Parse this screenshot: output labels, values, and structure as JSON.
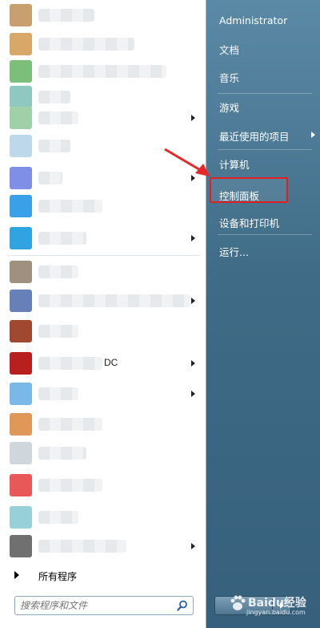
{
  "left_pane": {
    "programs": [
      {
        "icon_color": "#c8a070",
        "blur_w": 70,
        "arrow": false,
        "label": ""
      },
      {
        "icon_color": "#d8a868",
        "blur_w": 120,
        "arrow": false,
        "label": ""
      },
      {
        "icon_color": "#7bbf7b",
        "blur_w": 160,
        "arrow": false,
        "label": ""
      },
      {
        "icon_color": "#8fc7c1",
        "blur_w": 40,
        "arrow": false,
        "label": ""
      },
      {
        "icon_color": "#9fd0a8",
        "blur_w": 50,
        "arrow": true,
        "label": ""
      },
      {
        "icon_color": "#bcd8ea",
        "blur_w": 40,
        "arrow": false,
        "label": ""
      },
      {
        "icon_color": "#7f8fe8",
        "blur_w": 30,
        "arrow": true,
        "label": ""
      },
      {
        "icon_color": "#3aa0e8",
        "blur_w": 80,
        "arrow": false,
        "label": ""
      },
      {
        "icon_color": "#2fa4e0",
        "blur_w": 60,
        "arrow": true,
        "label": ""
      },
      {
        "icon_color": "#a09080",
        "blur_w": 50,
        "arrow": false,
        "label": ""
      },
      {
        "icon_color": "#6880b8",
        "blur_w": 190,
        "arrow": true,
        "label": ""
      },
      {
        "icon_color": "#a04830",
        "blur_w": 50,
        "arrow": false,
        "label": ""
      },
      {
        "icon_color": "#b82020",
        "blur_w": 80,
        "arrow": true,
        "label": "DC"
      },
      {
        "icon_color": "#7ab8e8",
        "blur_w": 50,
        "arrow": true,
        "label": ""
      },
      {
        "icon_color": "#e09858",
        "blur_w": 80,
        "arrow": false,
        "label": ""
      },
      {
        "icon_color": "#cfd6dc",
        "blur_w": 60,
        "arrow": false,
        "label": ""
      },
      {
        "icon_color": "#e85858",
        "blur_w": 80,
        "arrow": false,
        "label": ""
      },
      {
        "icon_color": "#98d0d8",
        "blur_w": 50,
        "arrow": false,
        "label": ""
      },
      {
        "icon_color": "#707070",
        "blur_w": 110,
        "arrow": true,
        "label": ""
      }
    ],
    "all_programs_label": "所有程序",
    "search_placeholder": "搜索程序和文件"
  },
  "right_pane": {
    "items": [
      {
        "label": "Administrator",
        "arrow": false
      },
      {
        "label": "文档",
        "arrow": false
      },
      {
        "label": "音乐",
        "arrow": false
      },
      {
        "label": "游戏",
        "arrow": false
      },
      {
        "label": "最近使用的项目",
        "arrow": true
      },
      {
        "label": "计算机",
        "arrow": false
      },
      {
        "label": "控制面板",
        "arrow": false
      },
      {
        "label": "设备和打印机",
        "arrow": false
      },
      {
        "label": "运行...",
        "arrow": false
      }
    ]
  },
  "watermark": {
    "text": "Baidu经验",
    "sub": "jingyan.baidu.com"
  },
  "colors": {
    "highlight": "#e02020",
    "pointer": "#e82828"
  }
}
